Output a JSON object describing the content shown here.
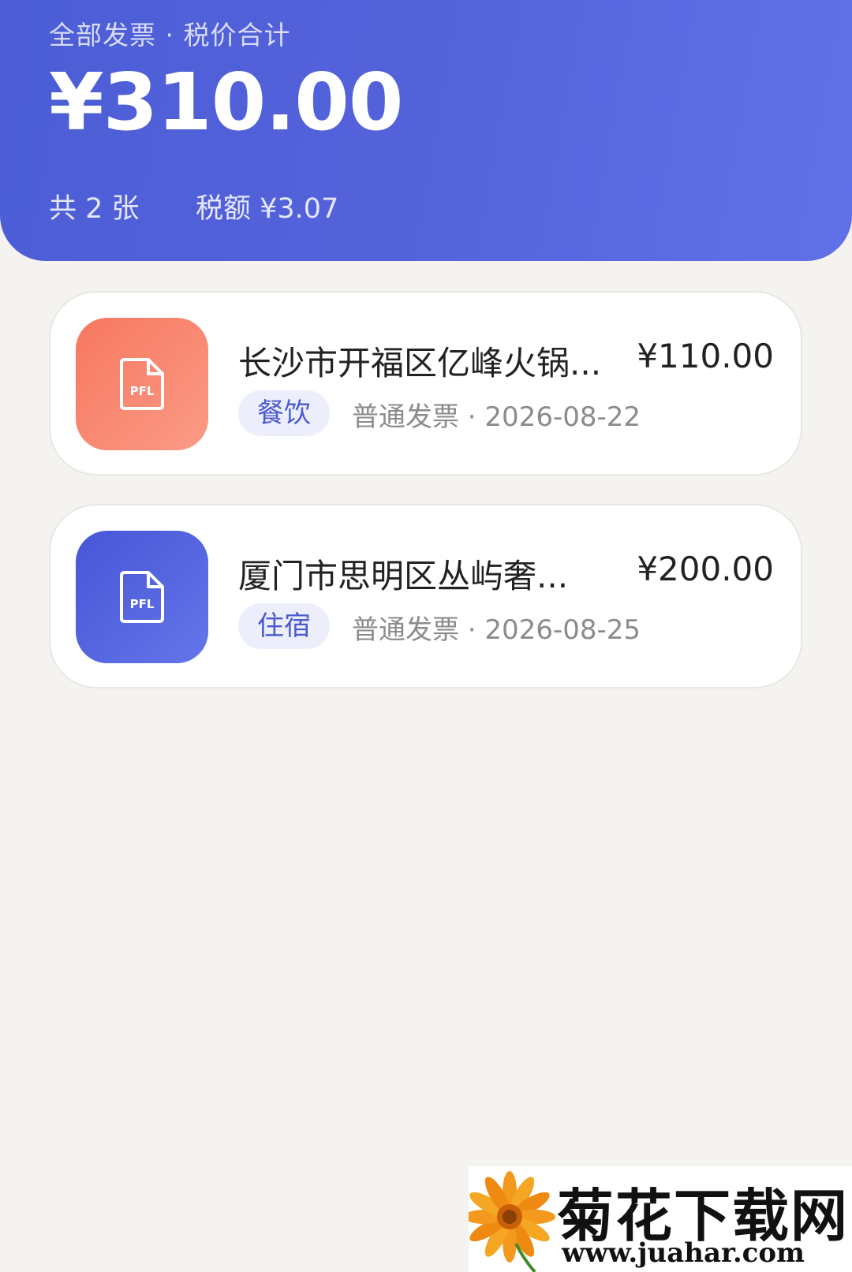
{
  "header": {
    "label": "全部发票 · 税价合计",
    "total": "¥310.00",
    "count": "共 2 张",
    "tax": "税额 ¥3.07",
    "gradient_start": "#4b5dd6",
    "gradient_end": "#6071e8"
  },
  "invoices": [
    {
      "title": "长沙市开福区亿峰火锅...",
      "amount": "¥110.00",
      "tag": "餐饮",
      "meta": "普通发票 · 2026-08-22",
      "icon": "pdf-file-icon",
      "icon_label": "PFL",
      "icon_color": "#f7775f"
    },
    {
      "title": "厦门市思明区丛屿奢...",
      "amount": "¥200.00",
      "tag": "住宿",
      "meta": "普通发票 · 2026-08-25",
      "icon": "pdf-file-icon",
      "icon_label": "PFL",
      "icon_color": "#4656d6"
    }
  ],
  "watermark": {
    "title": "菊花下载网",
    "url": "www.juahar.com"
  }
}
